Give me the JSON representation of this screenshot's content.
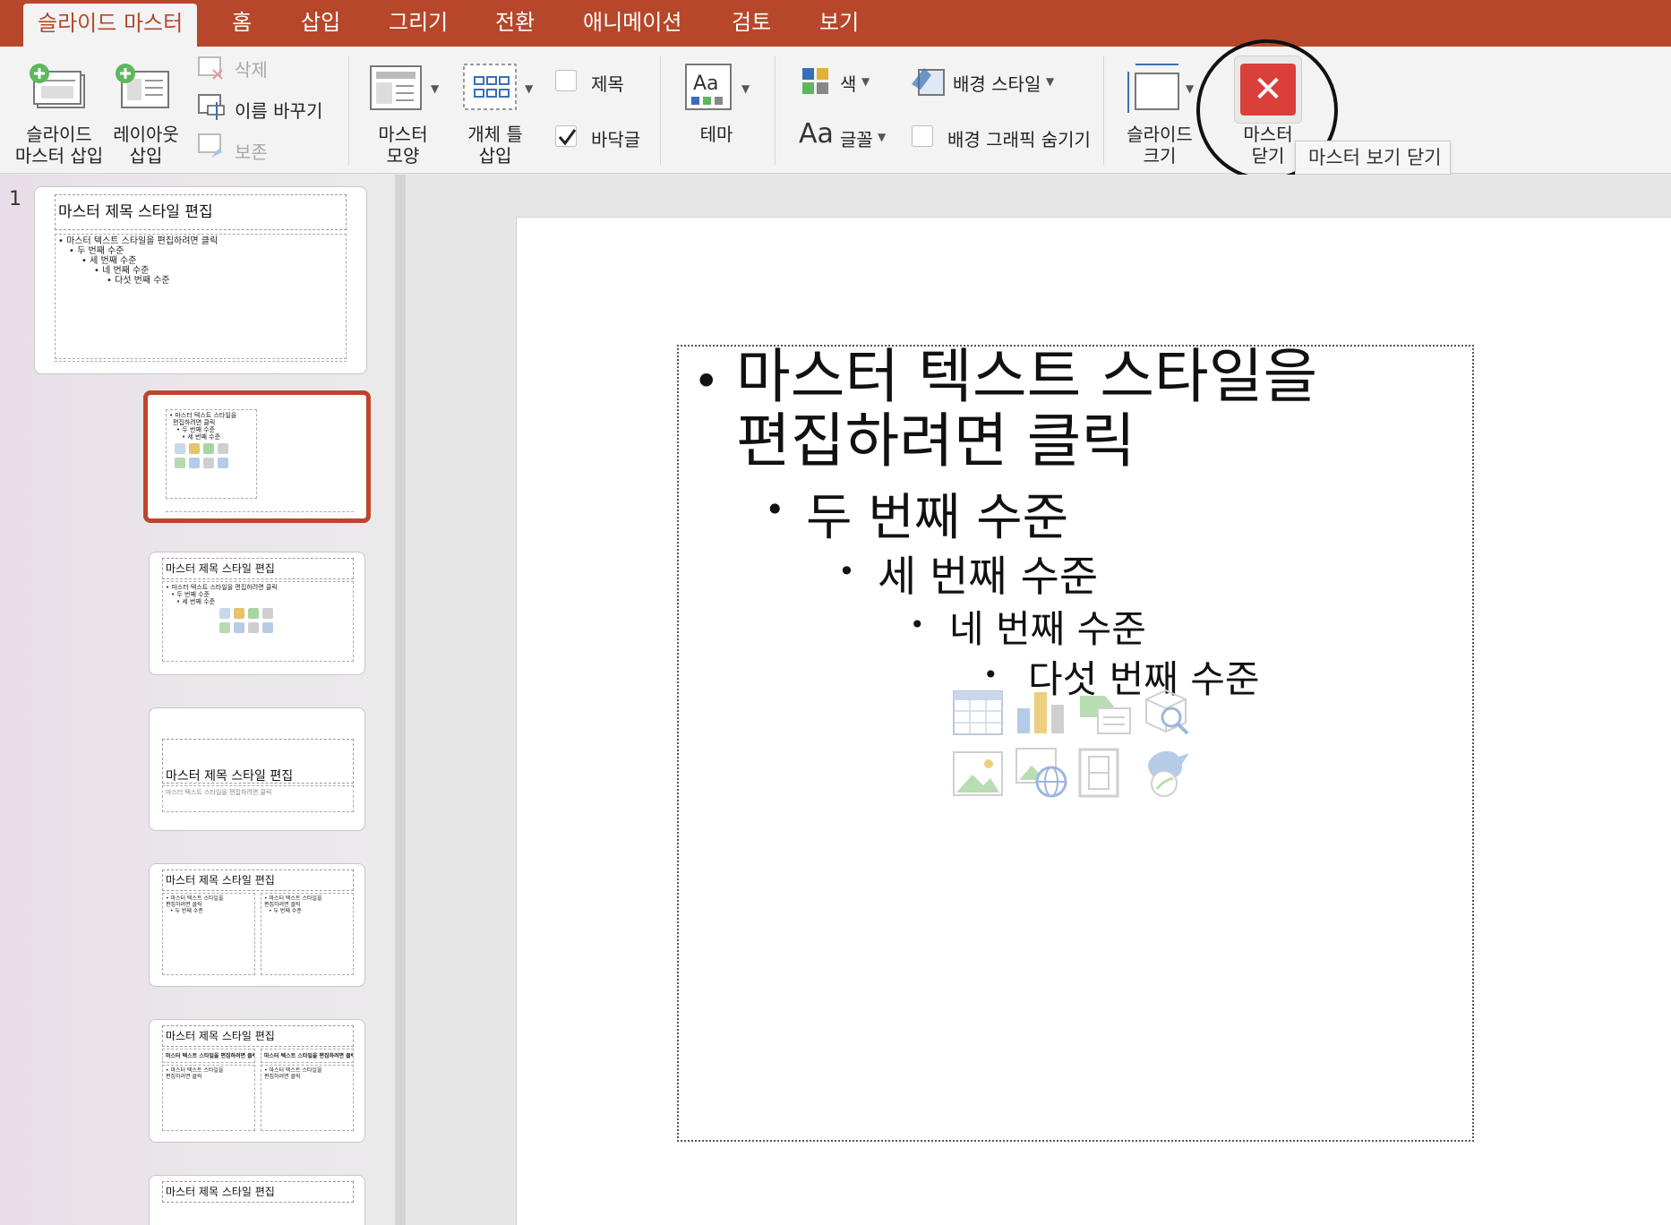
{
  "tabs": [
    {
      "label": "슬라이드 마스터",
      "active": true
    },
    {
      "label": "홈"
    },
    {
      "label": "삽입"
    },
    {
      "label": "그리기"
    },
    {
      "label": "전환"
    },
    {
      "label": "애니메이션"
    },
    {
      "label": "검토"
    },
    {
      "label": "보기"
    }
  ],
  "ribbon": {
    "insert_master": "슬라이드\n마스터 삽입",
    "insert_layout": "레이아웃\n삽입",
    "delete": "삭제",
    "rename": "이름 바꾸기",
    "preserve": "보존",
    "master_layout": "마스터\n모양",
    "insert_placeholder": "개체 틀\n삽입",
    "title_check": "제목",
    "footer_check": "바닥글",
    "themes": "테마",
    "colors": "색",
    "fonts": "글꼴",
    "fonts_icon": "Aa",
    "background_styles": "배경 스타일",
    "hide_bg_graphics": "배경 그래픽 숨기기",
    "slide_size": "슬라이드\n크기",
    "close_master": "마스터\n닫기",
    "tooltip": "마스터 보기 닫기"
  },
  "panel": {
    "slide_number": "1",
    "master_title": "마스터 제목 스타일 편집",
    "master_body": [
      "• 마스터 텍스트 스타일을 편집하려면 클릭",
      "• 두 번째 수준",
      "• 세 번째 수준",
      "• 네 번째 수준",
      "• 다섯 번째 수준"
    ],
    "layout_body": [
      "• 마스터 텍스트 스타일을",
      "편집하려면 클릭",
      "• 두 번째 수준",
      "• 세 번째 수준",
      "• 네 번째 수준",
      "• 다섯 번째 수준"
    ],
    "layout3_body": [
      "• 마스터 텍스트 스타일을 편집하려면 클릭",
      "• 두 번째 수준",
      "• 세 번째 수준",
      "• 네 번째 수준",
      "• 다섯 번째 수준"
    ],
    "layout4_sub": "마스터 텍스트 스타일을 편집하려면 클릭",
    "compare_head": "마스터 텍스트 스타일을 편집하려면 클릭"
  },
  "slide": {
    "bullet": "•",
    "level1_line1": "마스터 텍스트 스타일을",
    "level1_line2": "편집하려면 클릭",
    "level2": "두 번째 수준",
    "level3": "세 번째 수준",
    "level4": "네 번째 수준",
    "level5": "다섯 번째 수준"
  },
  "colors": {
    "accent": "#b7472a",
    "close_red": "#d9403a"
  }
}
